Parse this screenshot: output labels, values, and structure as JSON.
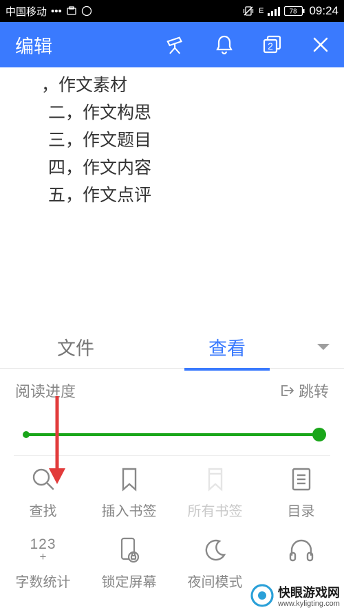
{
  "status": {
    "carrier": "中国移动",
    "network": "E",
    "battery": "78",
    "time": "09:24"
  },
  "header": {
    "title": "编辑",
    "window_badge": "2"
  },
  "content": {
    "lines": [
      "，作文素材",
      "二，作文构思",
      "三，作文题目",
      "四，作文内容",
      "五，作文点评"
    ]
  },
  "tabs": {
    "file": "文件",
    "view": "查看"
  },
  "progress": {
    "label": "阅读进度",
    "jump": "跳转"
  },
  "grid": {
    "search": "查找",
    "insert_bookmark": "插入书签",
    "all_bookmarks": "所有书签",
    "toc": "目录",
    "word_count": "字数统计",
    "lock_screen": "锁定屏幕",
    "night_mode": "夜间模式",
    "word_count_icon": "123"
  },
  "watermark": {
    "title": "快眼游戏网",
    "url": "www.kyligting.com"
  }
}
